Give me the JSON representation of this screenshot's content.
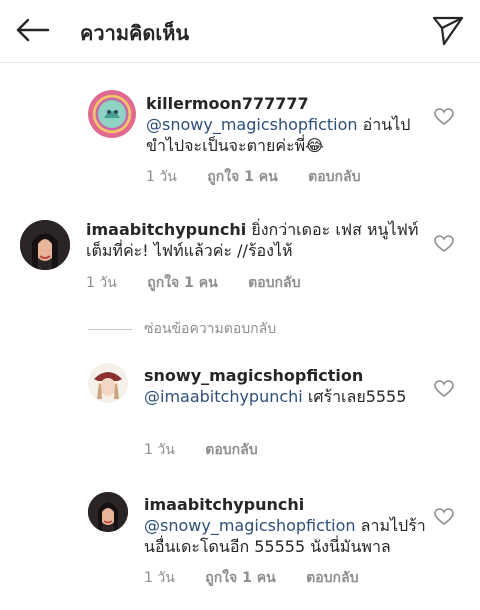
{
  "header": {
    "title": "ความคิดเห็น",
    "back_icon": "arrow-left-icon",
    "send_icon": "paper-plane-icon"
  },
  "comments": [
    {
      "username": "killermoon777777",
      "mention": "@snowy_magicshopfiction",
      "text": "อ่านไปขำไปจะเป็นจะตายค่ะพี่😂",
      "time": "1 วัน",
      "likes": "ถูกใจ 1 คน",
      "reply": "ตอบกลับ"
    },
    {
      "username": "imaabitchypunchi",
      "mention": "",
      "text": "ยิ่งกว่าเดอะ เฟส หนูไฟท์เต็มที่ค่ะ! ไฟท์แล้วค่ะ //ร้องไห้",
      "time": "1 วัน",
      "likes": "ถูกใจ 1 คน",
      "reply": "ตอบกลับ"
    },
    {
      "username": "snowy_magicshopfiction",
      "mention": "@imaabitchypunchi",
      "text": "เศร้าเลย5555",
      "time": "1 วัน",
      "likes": "",
      "reply": "ตอบกลับ"
    },
    {
      "username": "imaabitchypunchi",
      "mention": "@snowy_magicshopfiction",
      "text": "ลามไปร้านอื่นเดะโดนอีก 55555 นังนี่มันพาล",
      "time": "1 วัน",
      "likes": "ถูกใจ 1 คน",
      "reply": "ตอบกลับ"
    }
  ],
  "hide_replies_label": "ซ่อนข้อความตอบกลับ",
  "colors": {
    "mention": "#2d4f7a",
    "meta": "#8e8e8e",
    "text": "#262626"
  }
}
